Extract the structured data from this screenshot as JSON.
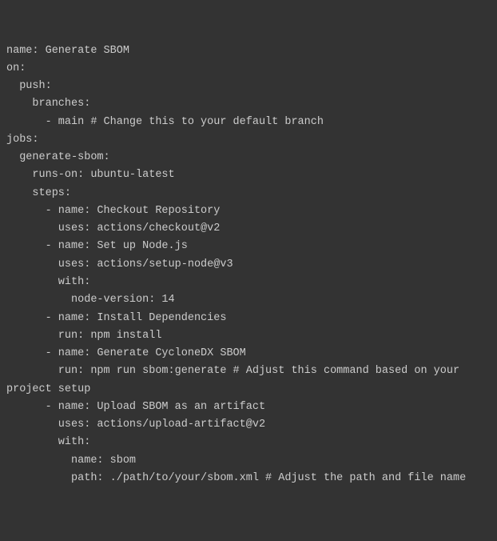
{
  "code": {
    "lines": [
      "name: Generate SBOM",
      "on:",
      "  push:",
      "    branches:",
      "      - main # Change this to your default branch",
      "jobs:",
      "  generate-sbom:",
      "    runs-on: ubuntu-latest",
      "    steps:",
      "      - name: Checkout Repository",
      "        uses: actions/checkout@v2",
      "      - name: Set up Node.js",
      "        uses: actions/setup-node@v3",
      "        with:",
      "          node-version: 14",
      "      - name: Install Dependencies",
      "        run: npm install",
      "      - name: Generate CycloneDX SBOM",
      "        run: npm run sbom:generate # Adjust this command based on your",
      "project setup",
      "      - name: Upload SBOM as an artifact",
      "        uses: actions/upload-artifact@v2",
      "        with:",
      "          name: sbom",
      "          path: ./path/to/your/sbom.xml # Adjust the path and file name"
    ]
  }
}
